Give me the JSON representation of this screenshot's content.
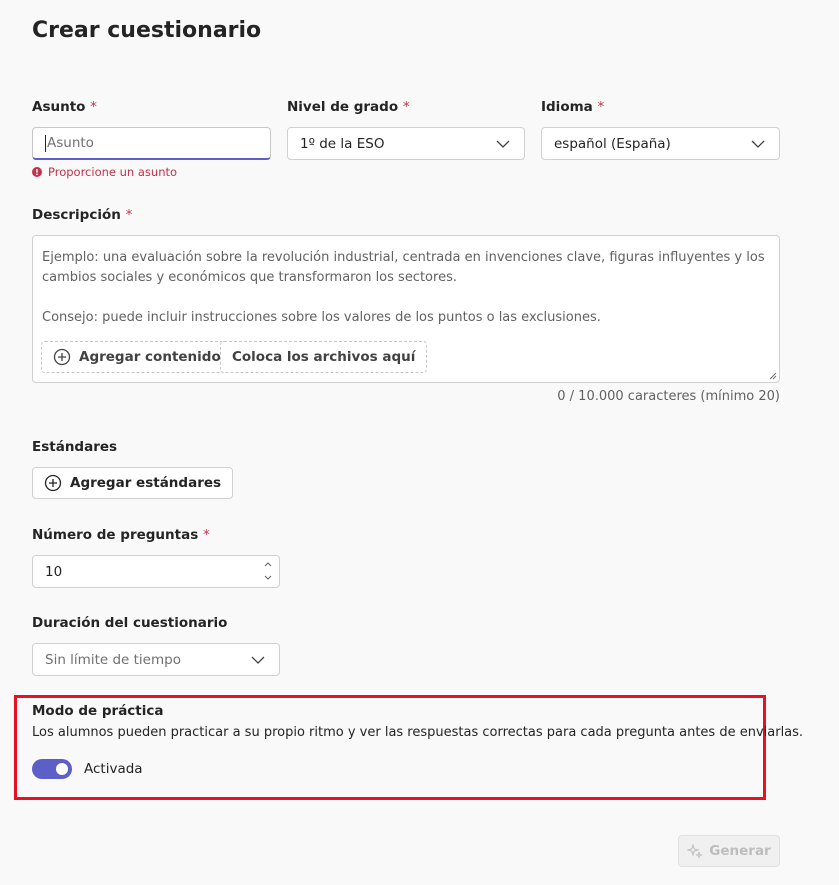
{
  "page": {
    "title": "Crear cuestionario"
  },
  "subject": {
    "label": "Asunto",
    "required_mark": "*",
    "placeholder": "Asunto",
    "error": "Proporcione un asunto"
  },
  "grade": {
    "label": "Nivel de grado",
    "required_mark": "*",
    "value": "1º de la ESO"
  },
  "language": {
    "label": "Idioma",
    "required_mark": "*",
    "value": "español (España)"
  },
  "description": {
    "label": "Descripción",
    "required_mark": "*",
    "example_line1": "Ejemplo: una evaluación sobre la revolución industrial, centrada en invenciones clave, figuras influyentes y los",
    "example_line2": "cambios sociales y económicos que transformaron los sectores.",
    "tip": "Consejo: puede incluir instrucciones sobre los valores de los puntos o las exclusiones.",
    "add_content_label": "Agregar contenido",
    "drop_files_label": "Coloca los archivos aquí",
    "char_count": "0 / 10.000 caracteres (mínimo 20)"
  },
  "standards": {
    "label": "Estándares",
    "add_button_label": "Agregar estándares"
  },
  "num_questions": {
    "label": "Número de preguntas",
    "required_mark": "*",
    "value": "10"
  },
  "duration": {
    "label": "Duración del cuestionario",
    "value": "Sin límite de tiempo"
  },
  "practice_mode": {
    "label": "Modo de práctica",
    "description": "Los alumnos pueden practicar a su propio ritmo y ver las respuestas correctas para cada pregunta antes de enviarlas.",
    "toggle_state_label": "Activada",
    "enabled": true
  },
  "generate": {
    "label": "Generar"
  },
  "colors": {
    "accent": "#5b5fc7",
    "error": "#c4314b",
    "highlight": "#e81123"
  }
}
